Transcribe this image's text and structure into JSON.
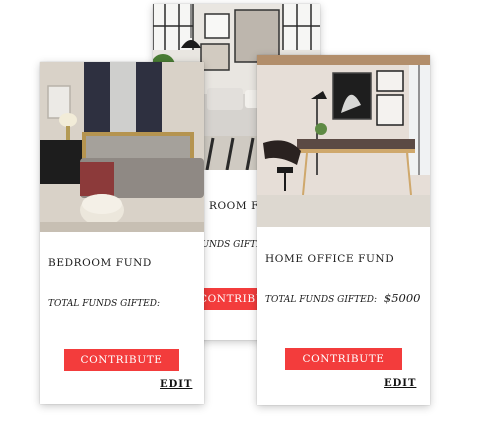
{
  "cards": [
    {
      "title": "BEDROOM FUND",
      "total_label": "TOTAL FUNDS GIFTED:",
      "amount": "",
      "button_label": "CONTRIBUTE",
      "edit_label": "EDIT"
    },
    {
      "title": "LIVING ROOM FUND",
      "total_label": "TOTAL FUNDS GIFTED:",
      "amount": "",
      "button_label": "CONTRIBUTE",
      "edit_label": ""
    },
    {
      "title": "HOME OFFICE FUND",
      "total_label": "TOTAL FUNDS GIFTED:",
      "amount": "$5000",
      "button_label": "CONTRIBUTE",
      "edit_label": "EDIT"
    }
  ],
  "colors": {
    "button": "#f33c3c",
    "text": "#1a1a1a"
  },
  "images": [
    "bedroom-photo",
    "living-room-photo",
    "home-office-photo"
  ]
}
